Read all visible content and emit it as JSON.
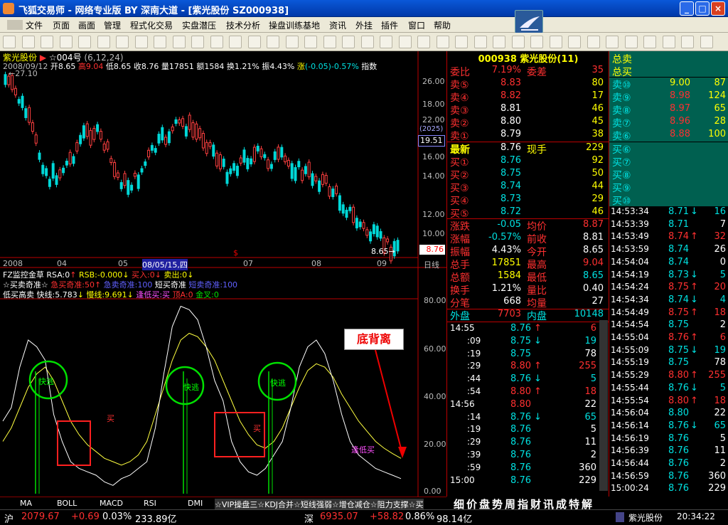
{
  "window": {
    "title": "飞狐交易师 - 网络专业版 BY 深南大道 - [紫光股份 SZ000938]",
    "min": "_",
    "max": "□",
    "close": "×"
  },
  "menu": [
    "文件",
    "页面",
    "画面",
    "管理",
    "程式化交易",
    "实盘潜压",
    "技术分析",
    "操盘训练基地",
    "资讯",
    "外挂",
    "插件",
    "窗口",
    "帮助"
  ],
  "chart": {
    "stock_name": "紫光股份",
    "indicator_tag": "☆004号",
    "params": "(6,12,24)",
    "info_line": {
      "date": "2008/09/12",
      "open_label": "开",
      "open": "8.65",
      "high_label": "高",
      "high": "9.04",
      "low_label": "低",
      "low": "8.65",
      "close_label": "收",
      "close": "8.76",
      "vol_label": "量",
      "vol": "17851",
      "amt_label": "额",
      "amt": "1584",
      "turn_label": "换",
      "turn": "1.21%",
      "amp_label": "振",
      "amp": "4.43%",
      "chg_label": "涨",
      "chg": "(-0.05)-0.57%",
      "idx": "指数"
    },
    "max_price_label": "27.10",
    "min_price_label": "8.65",
    "cur_price": "8.76",
    "right_axis_top": [
      "26.00",
      "22.00",
      "18.00",
      "16.00",
      "14.00",
      "12.00",
      "10.00"
    ],
    "crosshair_value": "19.51",
    "crosshair_tag": "(2025)",
    "period_label": "日线",
    "x_ticks": [
      "2008",
      "04",
      "05",
      "08/05/15,四",
      "07",
      "08",
      "09"
    ],
    "fz_line": {
      "name": "FZ监控金草",
      "rsa": "RSA:0",
      "rsb": "RSB:-0.000",
      "buy": "买入:0",
      "sell": "卖出:0"
    },
    "line3": {
      "a": "☆买卖奇准☆",
      "b": "急买奇准:50",
      "c": "急卖奇准:100",
      "d": "短买奇准",
      "e": "短卖奇准:100"
    },
    "line4": {
      "a": "低买高卖",
      "fast": "快线:5.783",
      "slow": "慢线:9.691",
      "low_buy": "逢低买:买",
      "top": "顶A:0",
      "gold": "金叉:0"
    },
    "osc_axis": [
      "80.00",
      "60.00",
      "40.00",
      "20.00",
      "0.00"
    ],
    "annot": {
      "kuaitao": "快逃",
      "buy": "买",
      "divergence": "底背离",
      "low_buy_text": "逢低买"
    }
  },
  "quote": {
    "code": "000938",
    "name": "紫光股份",
    "num": "(11)",
    "weibi_label": "委比",
    "weibi": "7.19%",
    "weicha_label": "委差",
    "weicha": "35",
    "sells": [
      {
        "l": "卖⑤",
        "p": "8.83",
        "v": "80"
      },
      {
        "l": "卖④",
        "p": "8.82",
        "v": "17"
      },
      {
        "l": "卖③",
        "p": "8.81",
        "v": "46"
      },
      {
        "l": "卖②",
        "p": "8.80",
        "v": "45"
      },
      {
        "l": "卖①",
        "p": "8.79",
        "v": "38"
      }
    ],
    "last_label": "最新",
    "last": "8.76",
    "hand_label": "现手",
    "hand": "229",
    "buys": [
      {
        "l": "买①",
        "p": "8.76",
        "v": "92"
      },
      {
        "l": "买②",
        "p": "8.75",
        "v": "50"
      },
      {
        "l": "买③",
        "p": "8.74",
        "v": "44"
      },
      {
        "l": "买④",
        "p": "8.73",
        "v": "29"
      },
      {
        "l": "买⑤",
        "p": "8.72",
        "v": "46"
      }
    ],
    "stats": [
      {
        "l1": "涨跌",
        "v1": "-0.05",
        "l2": "均价",
        "v2": "8.87"
      },
      {
        "l1": "涨幅",
        "v1": "-0.57%",
        "l2": "前收",
        "v2": "8.81"
      },
      {
        "l1": "振幅",
        "v1": "4.43%",
        "l2": "今开",
        "v2": "8.65"
      },
      {
        "l1": "总手",
        "v1": "17851",
        "l2": "最高",
        "v2": "9.04"
      },
      {
        "l1": "总额",
        "v1": "1584",
        "l2": "最低",
        "v2": "8.65"
      },
      {
        "l1": "换手",
        "v1": "1.21%",
        "l2": "量比",
        "v2": "0.40"
      },
      {
        "l1": "分笔",
        "v1": "668",
        "l2": "均量",
        "v2": "27"
      }
    ],
    "waipan_label": "外盘",
    "waipan": "7703",
    "neipan_label": "内盘",
    "neipan": "10148",
    "ticks": [
      {
        "t": "14:55",
        "p": "8.76",
        "a": "↑",
        "v": "6"
      },
      {
        "t": ":09",
        "p": "8.75",
        "a": "↓",
        "v": "19"
      },
      {
        "t": ":19",
        "p": "8.75",
        "a": "",
        "v": "78"
      },
      {
        "t": ":29",
        "p": "8.80",
        "a": "↑",
        "v": "255"
      },
      {
        "t": ":44",
        "p": "8.76",
        "a": "↓",
        "v": "5"
      },
      {
        "t": ":54",
        "p": "8.80",
        "a": "↑",
        "v": "18"
      },
      {
        "t": "14:56",
        "p": "8.80",
        "a": "",
        "v": "22"
      },
      {
        "t": ":14",
        "p": "8.76",
        "a": "↓",
        "v": "65"
      },
      {
        "t": ":19",
        "p": "8.76",
        "a": "",
        "v": "5"
      },
      {
        "t": ":29",
        "p": "8.76",
        "a": "",
        "v": "11"
      },
      {
        "t": ":39",
        "p": "8.76",
        "a": "",
        "v": "2"
      },
      {
        "t": ":59",
        "p": "8.76",
        "a": "",
        "v": "360"
      },
      {
        "t": "15:00",
        "p": "8.76",
        "a": "",
        "v": "229"
      }
    ]
  },
  "queue": {
    "total_sell": "总卖",
    "total_buy": "总买",
    "sells": [
      {
        "l": "卖⑩",
        "p": "9.00",
        "v": "87"
      },
      {
        "l": "卖⑨",
        "p": "8.98",
        "v": "124"
      },
      {
        "l": "卖⑧",
        "p": "8.97",
        "v": "65"
      },
      {
        "l": "卖⑦",
        "p": "8.96",
        "v": "28"
      },
      {
        "l": "卖⑥",
        "p": "8.88",
        "v": "100"
      }
    ],
    "buys": [
      "买⑥",
      "买⑦",
      "买⑧",
      "买⑨",
      "买⑩"
    ],
    "ticks": [
      {
        "t": "14:53:34",
        "p": "8.71",
        "a": "↓",
        "v": "16"
      },
      {
        "t": "14:53:39",
        "p": "8.71",
        "a": "",
        "v": "7"
      },
      {
        "t": "14:53:49",
        "p": "8.74",
        "a": "↑",
        "v": "32"
      },
      {
        "t": "14:53:59",
        "p": "8.74",
        "a": "",
        "v": "26"
      },
      {
        "t": "14:54:04",
        "p": "8.74",
        "a": "",
        "v": "0"
      },
      {
        "t": "14:54:19",
        "p": "8.73",
        "a": "↓",
        "v": "5"
      },
      {
        "t": "14:54:24",
        "p": "8.75",
        "a": "↑",
        "v": "20"
      },
      {
        "t": "14:54:34",
        "p": "8.74",
        "a": "↓",
        "v": "4"
      },
      {
        "t": "14:54:49",
        "p": "8.75",
        "a": "↑",
        "v": "18"
      },
      {
        "t": "14:54:54",
        "p": "8.75",
        "a": "",
        "v": "2"
      },
      {
        "t": "14:55:04",
        "p": "8.76",
        "a": "↑",
        "v": "6"
      },
      {
        "t": "14:55:09",
        "p": "8.75",
        "a": "↓",
        "v": "19"
      },
      {
        "t": "14:55:19",
        "p": "8.75",
        "a": "",
        "v": "78"
      },
      {
        "t": "14:55:29",
        "p": "8.80",
        "a": "↑",
        "v": "255"
      },
      {
        "t": "14:55:44",
        "p": "8.76",
        "a": "↓",
        "v": "5"
      },
      {
        "t": "14:55:54",
        "p": "8.80",
        "a": "↑",
        "v": "18"
      },
      {
        "t": "14:56:04",
        "p": "8.80",
        "a": "",
        "v": "22"
      },
      {
        "t": "14:56:14",
        "p": "8.76",
        "a": "↓",
        "v": "65"
      },
      {
        "t": "14:56:19",
        "p": "8.76",
        "a": "",
        "v": "5"
      },
      {
        "t": "14:56:39",
        "p": "8.76",
        "a": "",
        "v": "11"
      },
      {
        "t": "14:56:44",
        "p": "8.76",
        "a": "",
        "v": "2"
      },
      {
        "t": "14:56:59",
        "p": "8.76",
        "a": "",
        "v": "360"
      },
      {
        "t": "15:00:24",
        "p": "8.76",
        "a": "",
        "v": "229"
      }
    ]
  },
  "tabs": [
    "MA",
    "BOLL",
    "MACD",
    "RSI",
    "DMI"
  ],
  "ticker_text": "☆VIP操盘三☆KDJ合并☆短线强弱☆增仓减仓☆阻力支撑☆买",
  "ticker_tabs": "细价盘势周指财讯成特解",
  "status": {
    "sh_label": "沪",
    "sh_val": "2079.67",
    "sh_chg": "+0.69",
    "sh_pct": "0.03%",
    "sh_amt": "233.89亿",
    "sz_label": "深",
    "sz_val": "6935.07",
    "sz_chg": "+58.82",
    "sz_pct": "0.86%",
    "sz_amt": "98.14亿",
    "stock": "紫光股份",
    "time": "20:34:22"
  }
}
